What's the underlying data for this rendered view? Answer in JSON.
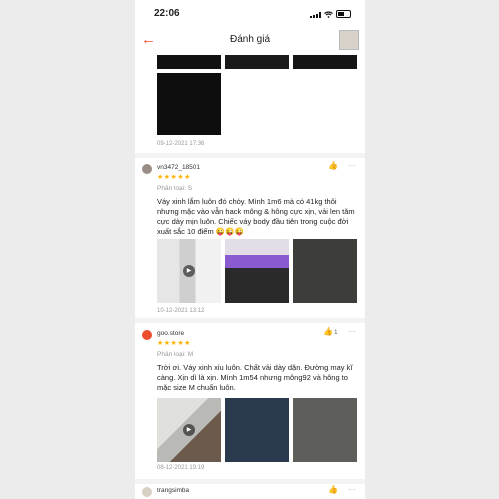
{
  "status_bar": {
    "time": "22:06"
  },
  "header": {
    "title": "Đánh giá"
  },
  "top_review": {
    "timestamp": "09-12-2021 17:36"
  },
  "reviews": [
    {
      "username": "vn3472_18501",
      "stars": "★★★★★",
      "variant": "Phân loại: S",
      "text": "Váy xinh lắm luôn đó chòy. Mình 1m6 mà có 41kg thôi nhưng mặc vào vẫn hack mông & hông cực xịn, vải len tăm cực dày mịn luôn. Chiếc váy body đầu tiên trong cuộc đời xuất sắc 10 điểm 😜😜😜",
      "timestamp": "10-12-2021 13:12",
      "like_count": ""
    },
    {
      "username": "goo.store",
      "stars": "★★★★★",
      "variant": "Phân loại: M",
      "text": "Trời ơi. Váy xinh xỉu luôn. Chất vải dày dặn. Đường may kĩ càng. Xịn dì là xịn. Mình 1m54 nhưng mông92 và hông to mặc size M chuẩn luôn.",
      "timestamp": "08-12-2021 19:19",
      "like_count": "1"
    },
    {
      "username": "trangsimba",
      "like_count": ""
    }
  ],
  "icons": {
    "back": "←",
    "like": "👍",
    "more": "···",
    "play": "▶"
  }
}
